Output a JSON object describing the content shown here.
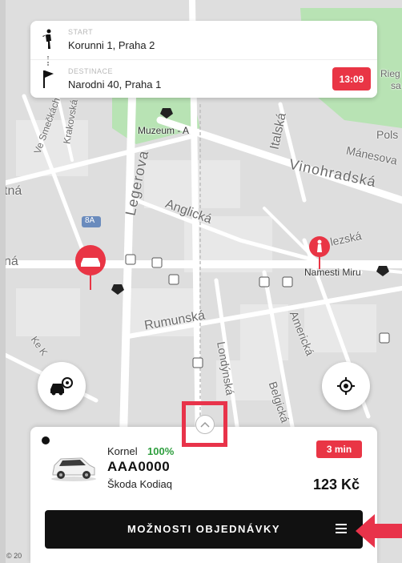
{
  "colors": {
    "accent": "#e93545",
    "rating": "#2e9e3e",
    "button": "#111111"
  },
  "route": {
    "start_caption": "START",
    "start_address": "Korunni 1, Praha 2",
    "destination_caption": "DESTINACE",
    "destination_address": "Narodni 40, Praha 1",
    "eta": "13:09"
  },
  "map": {
    "labels": {
      "vinohradska": "Vinohradská",
      "legerova": "Legerova",
      "anglicka": "Anglická",
      "italska": "Italská",
      "manesova": "Mánesova",
      "muzeum": "Muzeum - A",
      "rumunska": "Rumunská",
      "londynska": "Londýnská",
      "americka": "Americká",
      "belgicka": "Belgická",
      "namesti_miru": "Namesti Miru",
      "ve_smeckach": "Ve Smečkách",
      "krakovska": "Krakovská",
      "polska": "Pols",
      "rieg": "Rieg",
      "sa": "sa",
      "vezska": "lezská",
      "na_left": "ná",
      "tna_left": "tná",
      "ke": "Ke K",
      "route_badge": "8A"
    },
    "copyright": "© 20"
  },
  "icons": {
    "start": "walking-person-icon",
    "destination": "flag-icon",
    "nearby": "car-locate-icon",
    "locate": "crosshair-icon",
    "expand": "chevron-up-icon",
    "menu": "hamburger-icon"
  },
  "ride": {
    "driver_name": "Kornel",
    "rating": "100%",
    "plate": "AAA0000",
    "car_model": "Škoda Kodiaq",
    "arrival": "3 min",
    "price": "123 Kč"
  },
  "actions": {
    "options_label": "MOŽNOSTI OBJEDNÁVKY"
  }
}
